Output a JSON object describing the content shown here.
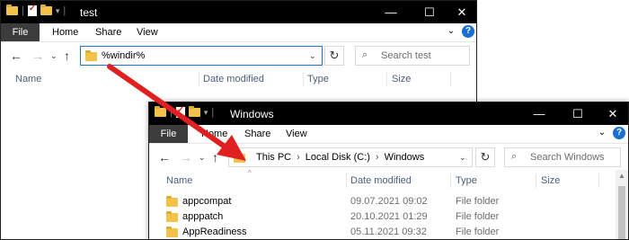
{
  "back_window": {
    "title": "test",
    "ribbon_tabs": [
      "File",
      "Home",
      "Share",
      "View"
    ],
    "address": "%windir%",
    "search_placeholder": "Search test",
    "columns": [
      "Name",
      "Date modified",
      "Type",
      "Size"
    ]
  },
  "front_window": {
    "title": "Windows",
    "ribbon_tabs": [
      "File",
      "Home",
      "Share",
      "View"
    ],
    "breadcrumb": [
      "This PC",
      "Local Disk (C:)",
      "Windows"
    ],
    "search_placeholder": "Search Windows",
    "columns": [
      "Name",
      "Date modified",
      "Type",
      "Size"
    ],
    "rows": [
      {
        "name": "appcompat",
        "date": "09.07.2021 09:02",
        "type": "File folder"
      },
      {
        "name": "apppatch",
        "date": "20.10.2021 01:29",
        "type": "File folder"
      },
      {
        "name": "AppReadiness",
        "date": "05.11.2021 09:32",
        "type": "File folder"
      }
    ]
  },
  "window_controls": {
    "minimize": "—",
    "maximize": "☐",
    "close": "✕"
  },
  "icons": {
    "folder": "folder-icon",
    "back": "back-arrow-icon",
    "forward": "forward-arrow-icon",
    "up": "up-arrow-icon",
    "refresh": "refresh-icon",
    "search": "search-icon",
    "help": "help-icon"
  },
  "colors": {
    "annotation_arrow": "#e02020",
    "address_focus_border": "#1a73d8",
    "file_tab": "#3c3c3c"
  }
}
